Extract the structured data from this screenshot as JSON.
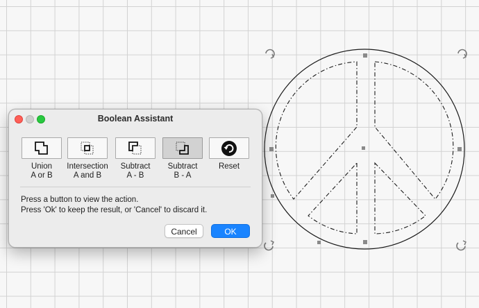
{
  "dialog": {
    "title": "Boolean Assistant",
    "tools": [
      {
        "line1": "Union",
        "line2": "A or B",
        "icon": "union-icon",
        "active": false
      },
      {
        "line1": "Intersection",
        "line2": "A and B",
        "icon": "intersection-icon",
        "active": false
      },
      {
        "line1": "Subtract",
        "line2": "A - B",
        "icon": "subtract-a-b-icon",
        "active": false
      },
      {
        "line1": "Subtract",
        "line2": "B - A",
        "icon": "subtract-b-a-icon",
        "active": true
      },
      {
        "line1": "Reset",
        "line2": "",
        "icon": "reset-icon",
        "active": false
      }
    ],
    "instruction_1": "Press a button to view the action.",
    "instruction_2": "Press 'Ok' to keep the result, or 'Cancel' to discard it.",
    "cancel_label": "Cancel",
    "ok_label": "OK"
  },
  "colors": {
    "accent": "#1a84ff",
    "close": "#fe5f57",
    "zoom": "#28c840"
  }
}
